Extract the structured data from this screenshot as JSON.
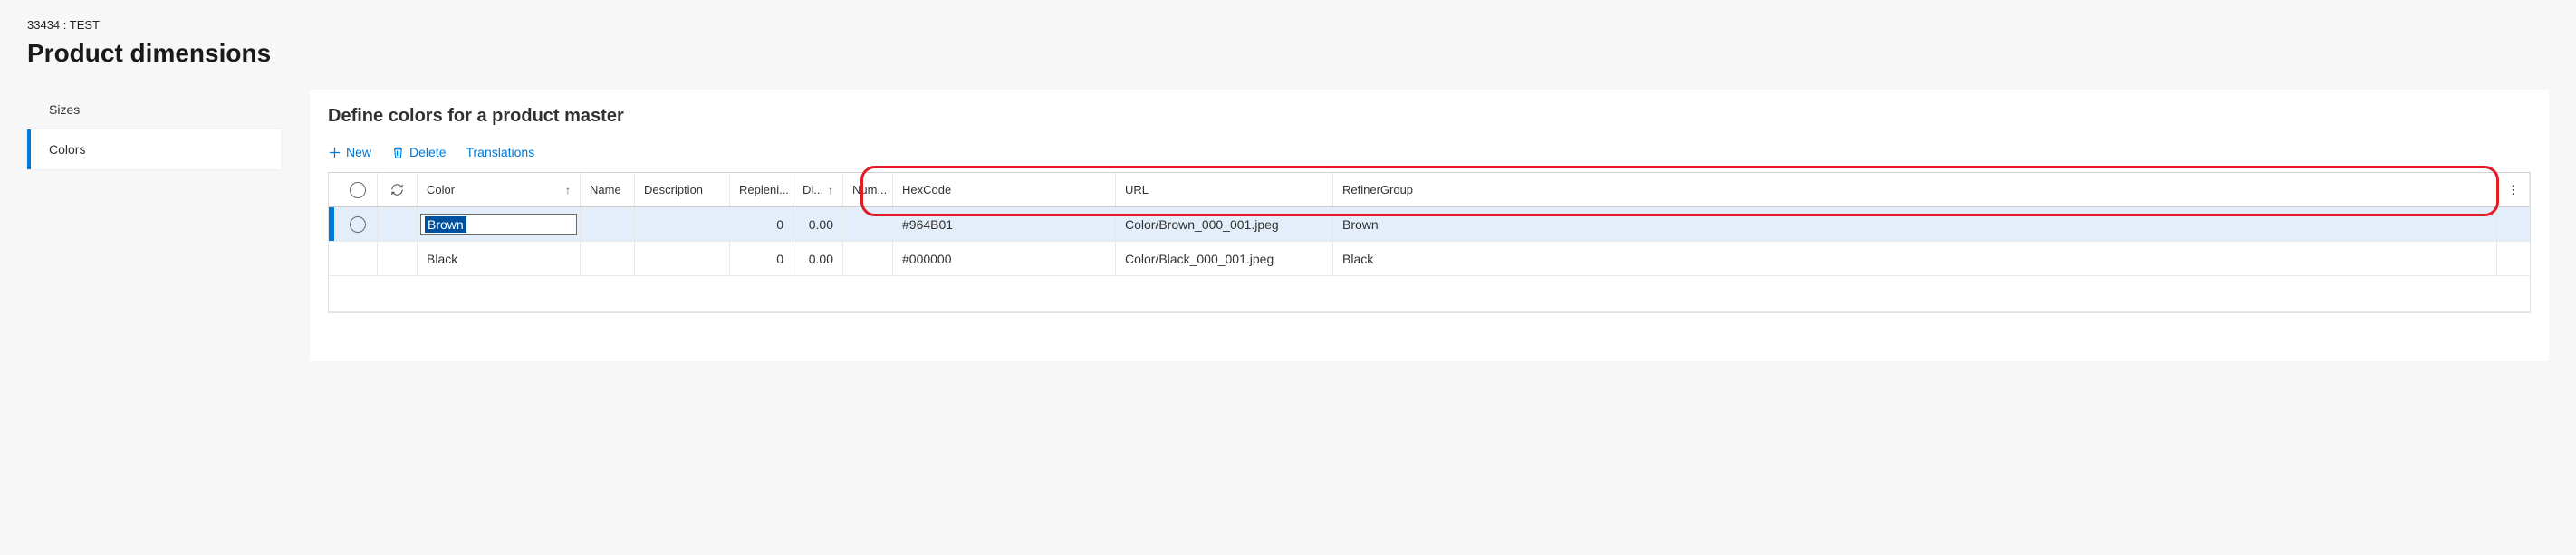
{
  "breadcrumb": "33434 : TEST",
  "page_title": "Product dimensions",
  "sidebar": {
    "tabs": [
      {
        "label": "Sizes",
        "active": false
      },
      {
        "label": "Colors",
        "active": true
      }
    ]
  },
  "section_title": "Define colors for a product master",
  "toolbar": {
    "new_label": "New",
    "delete_label": "Delete",
    "translations_label": "Translations"
  },
  "grid": {
    "headers": {
      "color": "Color",
      "name": "Name",
      "description": "Description",
      "replen": "Repleni...",
      "di": "Di...",
      "num": "Num...",
      "hex": "HexCode",
      "url": "URL",
      "refiner": "RefinerGroup"
    },
    "rows": [
      {
        "selected": true,
        "editing": true,
        "color": "Brown",
        "name": "",
        "description": "",
        "replen": "0",
        "di": "0.00",
        "num": "",
        "hex": "#964B01",
        "url": "Color/Brown_000_001.jpeg",
        "refiner": "Brown"
      },
      {
        "selected": false,
        "editing": false,
        "color": "Black",
        "name": "",
        "description": "",
        "replen": "0",
        "di": "0.00",
        "num": "",
        "hex": "#000000",
        "url": "Color/Black_000_001.jpeg",
        "refiner": "Black"
      }
    ]
  }
}
